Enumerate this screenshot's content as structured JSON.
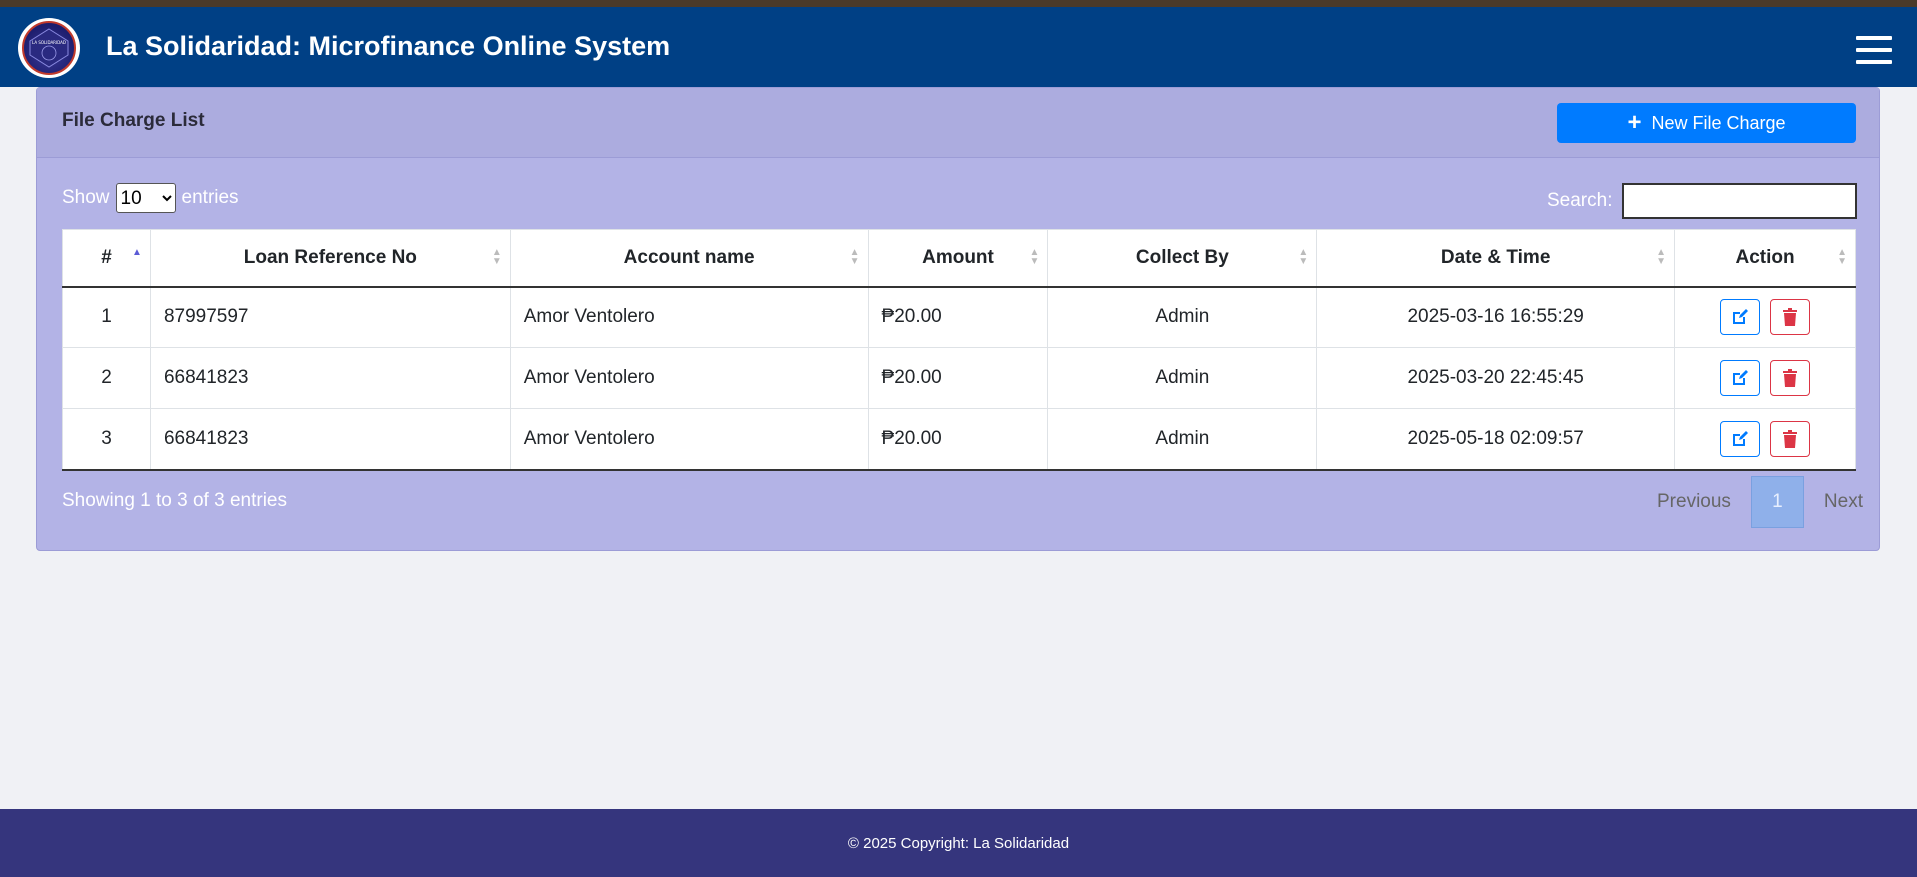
{
  "app": {
    "title": "La Solidaridad: Microfinance Online System",
    "logo_text": "LA SOLIDARIDAD"
  },
  "card": {
    "title": "File Charge List",
    "new_button_label": "New File Charge"
  },
  "table_controls": {
    "show_label": "Show",
    "entries_label": "entries",
    "page_length": "10",
    "search_label": "Search:",
    "search_value": ""
  },
  "table": {
    "columns": [
      "#",
      "Loan Reference No",
      "Account name",
      "Amount",
      "Collect By",
      "Date & Time",
      "Action"
    ],
    "rows": [
      {
        "num": "1",
        "loan_ref": "87997597",
        "account": "Amor Ventolero",
        "amount": "₱20.00",
        "collect_by": "Admin",
        "datetime": "2025-03-16 16:55:29"
      },
      {
        "num": "2",
        "loan_ref": "66841823",
        "account": "Amor Ventolero",
        "amount": "₱20.00",
        "collect_by": "Admin",
        "datetime": "2025-03-20 22:45:45"
      },
      {
        "num": "3",
        "loan_ref": "66841823",
        "account": "Amor Ventolero",
        "amount": "₱20.00",
        "collect_by": "Admin",
        "datetime": "2025-05-18 02:09:57"
      }
    ]
  },
  "pagination": {
    "info": "Showing 1 to 3 of 3 entries",
    "previous": "Previous",
    "current": "1",
    "next": "Next"
  },
  "footer": {
    "text": "© 2025 Copyright: La Solidaridad"
  },
  "colors": {
    "navbar": "#004085",
    "card": "#b3b3e6",
    "primary": "#007bff",
    "danger": "#dc3545",
    "footer": "#35357d"
  }
}
